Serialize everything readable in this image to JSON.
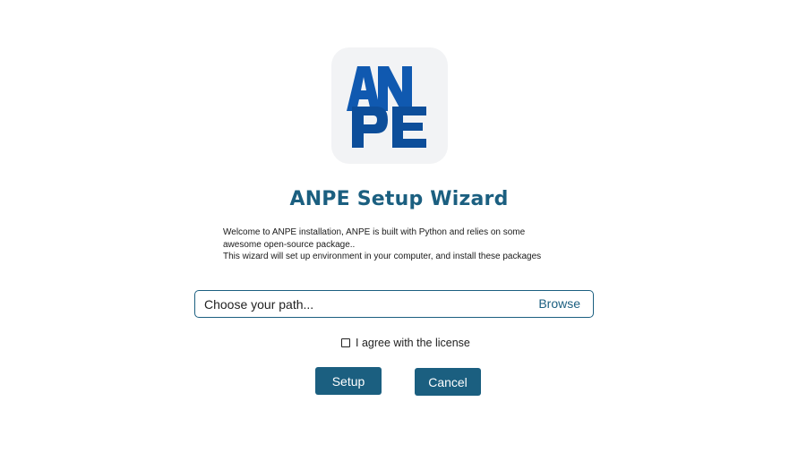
{
  "logo": {
    "text": "ANPE",
    "colors": {
      "background": "#f2f3f5",
      "primary": "#1059b0",
      "secondary": "#0d4e9a"
    }
  },
  "header": {
    "title": "ANPE Setup Wizard"
  },
  "description": {
    "lines": [
      "Welcome to ANPE installation, ANPE is built with Python and relies on some",
      "awesome open-source package..",
      "This wizard will set up environment in your computer, and install these packages"
    ]
  },
  "path": {
    "placeholder": "Choose your path...",
    "value": "",
    "browse_label": "Browse"
  },
  "license": {
    "label": "I agree with the license",
    "checked": false
  },
  "actions": {
    "setup_label": "Setup",
    "cancel_label": "Cancel"
  },
  "colors": {
    "accent": "#1b5f80",
    "background": "#ffffff"
  }
}
